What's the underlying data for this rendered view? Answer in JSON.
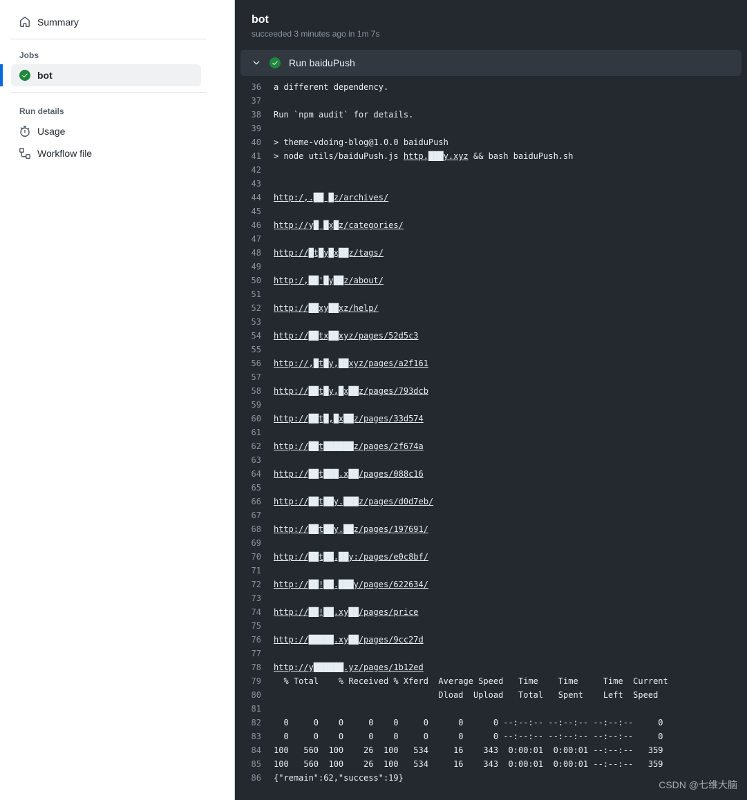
{
  "sidebar": {
    "summary": "Summary",
    "jobs_header": "Jobs",
    "job_item": "bot",
    "run_details_header": "Run details",
    "usage": "Usage",
    "workflow_file": "Workflow file"
  },
  "header": {
    "title": "bot",
    "status": "succeeded 3 minutes ago in 1m 7s"
  },
  "step": {
    "label": "Run baiduPush"
  },
  "watermark": "CSDN @七维大脑",
  "log": [
    {
      "n": 36,
      "t": "a different dependency."
    },
    {
      "n": 37,
      "t": ""
    },
    {
      "n": 38,
      "t": "Run `npm audit` for details."
    },
    {
      "n": 39,
      "t": ""
    },
    {
      "n": 40,
      "t": "> theme-vdoing-blog@1.0.0 baiduPush"
    },
    {
      "n": 41,
      "pre": "> node utils/baiduPush.js ",
      "url": "http.​███​y.xyz",
      "post": " && bash baiduPush.sh"
    },
    {
      "n": 42,
      "t": ""
    },
    {
      "n": 43,
      "t": ""
    },
    {
      "n": 44,
      "url": "http:/,​.██ █z/archives/"
    },
    {
      "n": 45,
      "t": ""
    },
    {
      "n": 46,
      "url": "http://y​█ █x█z/categories/"
    },
    {
      "n": 47,
      "t": ""
    },
    {
      "n": 48,
      "url": "http://​█t█y█x██z/tags/"
    },
    {
      "n": 49,
      "t": ""
    },
    {
      "n": 50,
      "url": "http:/,​██'█y██z/about/"
    },
    {
      "n": 51,
      "t": ""
    },
    {
      "n": 52,
      "url": "http://​██xy██xz/help/"
    },
    {
      "n": 53,
      "t": ""
    },
    {
      "n": 54,
      "url": "http://​██tx██xyz/pages/52d5c3"
    },
    {
      "n": 55,
      "t": ""
    },
    {
      "n": 56,
      "url": "http://,​█t█y,██xyz/pages/a2f161"
    },
    {
      "n": 57,
      "t": ""
    },
    {
      "n": 58,
      "url": "http://​██t█y,█x██z/pages/793dcb"
    },
    {
      "n": 59,
      "t": ""
    },
    {
      "n": 60,
      "url": "http://​██t█,█x██z/pages/33d574"
    },
    {
      "n": 61,
      "t": ""
    },
    {
      "n": 62,
      "url": "http://​██t██████z/pages/2f674a"
    },
    {
      "n": 63,
      "t": ""
    },
    {
      "n": 64,
      "url": "http://​██t███.x██/pages/088c16"
    },
    {
      "n": 65,
      "t": ""
    },
    {
      "n": 66,
      "url": "http://​██t██y.███z/pages/d0d7eb/"
    },
    {
      "n": 67,
      "t": ""
    },
    {
      "n": 68,
      "url": "http://​██t██y.██z/pages/197691/"
    },
    {
      "n": 69,
      "t": ""
    },
    {
      "n": 70,
      "url": "http://​██t██.██y:/pages/e0c8bf/"
    },
    {
      "n": 71,
      "t": ""
    },
    {
      "n": 72,
      "url": "http://​██!██.███y/pages/622634/"
    },
    {
      "n": 73,
      "t": ""
    },
    {
      "n": 74,
      "url": "http://​██!██.xy██/pages/price"
    },
    {
      "n": 75,
      "t": ""
    },
    {
      "n": 76,
      "url": "http://​█████.xy██/pages/9cc27d"
    },
    {
      "n": 77,
      "t": ""
    },
    {
      "n": 78,
      "url": "http://y██████.yz/pages/1b12ed"
    },
    {
      "n": 79,
      "t": "  % Total    % Received % Xferd  Average Speed   Time    Time     Time  Current"
    },
    {
      "n": 80,
      "t": "                                 Dload  Upload   Total   Spent    Left  Speed"
    },
    {
      "n": 81,
      "t": ""
    },
    {
      "n": 82,
      "t": "  0     0    0     0    0     0      0      0 --:--:-- --:--:-- --:--:--     0"
    },
    {
      "n": 83,
      "t": "  0     0    0     0    0     0      0      0 --:--:-- --:--:-- --:--:--     0"
    },
    {
      "n": 84,
      "t": "100   560  100    26  100   534     16    343  0:00:01  0:00:01 --:--:--   359"
    },
    {
      "n": 85,
      "t": "100   560  100    26  100   534     16    343  0:00:01  0:00:01 --:--:--   359"
    },
    {
      "n": 86,
      "t": "{\"remain\":62,\"success\":19}"
    }
  ]
}
